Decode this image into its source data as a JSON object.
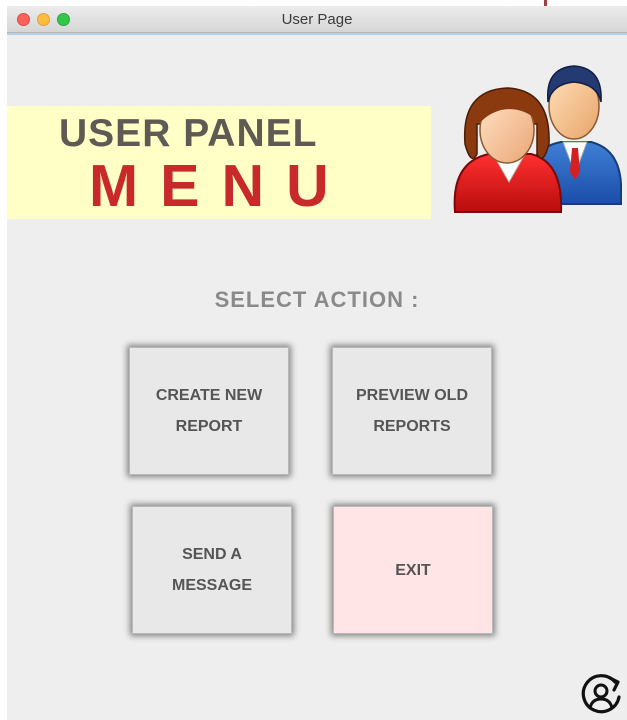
{
  "window": {
    "title": "User Page"
  },
  "banner": {
    "line1": "USER PANEL",
    "line2": "MENU",
    "background_color": "#ffffc6",
    "line1_color": "#5f5a54",
    "line2_color": "#c8292b"
  },
  "icons": {
    "users": "users-group-icon",
    "corner": "account-refresh-icon"
  },
  "main": {
    "select_label": "SELECT ACTION :",
    "actions": [
      {
        "line1": "CREATE NEW",
        "line2": "REPORT"
      },
      {
        "line1": "PREVIEW OLD",
        "line2": "REPORTS"
      },
      {
        "line1": "SEND A",
        "line2": "MESSAGE"
      },
      {
        "line1": "EXIT",
        "line2": ""
      }
    ],
    "exit_background": "#ffe5e6"
  }
}
